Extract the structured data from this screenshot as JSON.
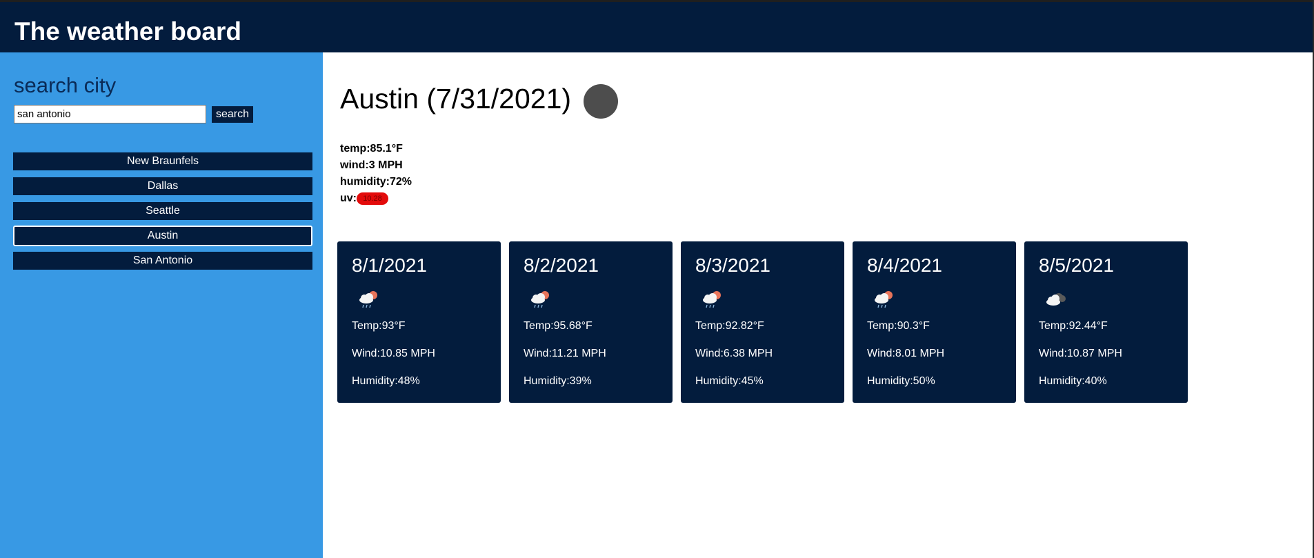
{
  "header": {
    "title": "The weather board"
  },
  "sidebar": {
    "heading": "search city",
    "search_value": "san antonio",
    "search_button_label": "search",
    "history": [
      {
        "label": "New Braunfels",
        "active": false
      },
      {
        "label": "Dallas",
        "active": false
      },
      {
        "label": "Seattle",
        "active": false
      },
      {
        "label": "Austin",
        "active": true
      },
      {
        "label": "San Antonio",
        "active": false
      }
    ]
  },
  "current": {
    "title": "Austin (7/31/2021)",
    "icon": "weather-icon-placeholder",
    "temp": "temp:85.1°F",
    "wind": "wind:3 MPH",
    "humidity": "humidity:72%",
    "uv_label": "uv:",
    "uv_value": "10.28",
    "uv_color": "#e30b0b"
  },
  "forecast": [
    {
      "date": "8/1/2021",
      "icon": "rain-sun-cloud-icon",
      "temp": "Temp:93°F",
      "wind": "Wind:10.85 MPH",
      "humidity": "Humidity:48%"
    },
    {
      "date": "8/2/2021",
      "icon": "rain-sun-cloud-icon",
      "temp": "Temp:95.68°F",
      "wind": "Wind:11.21 MPH",
      "humidity": "Humidity:39%"
    },
    {
      "date": "8/3/2021",
      "icon": "rain-sun-cloud-icon",
      "temp": "Temp:92.82°F",
      "wind": "Wind:6.38 MPH",
      "humidity": "Humidity:45%"
    },
    {
      "date": "8/4/2021",
      "icon": "rain-sun-cloud-icon",
      "temp": "Temp:90.3°F",
      "wind": "Wind:8.01 MPH",
      "humidity": "Humidity:50%"
    },
    {
      "date": "8/5/2021",
      "icon": "broken-clouds-icon",
      "temp": "Temp:92.44°F",
      "wind": "Wind:10.87 MPH",
      "humidity": "Humidity:40%"
    }
  ],
  "colors": {
    "navy": "#031c3d",
    "sidebar_blue": "#3899e4",
    "heading_blue": "#0a2b57"
  }
}
